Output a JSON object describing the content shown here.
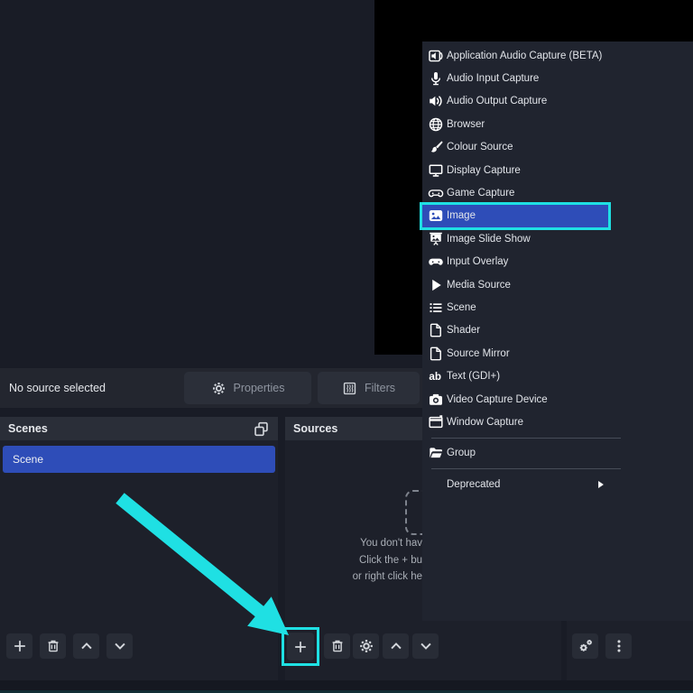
{
  "colors": {
    "accent_cyan": "#1fe0e3",
    "selection_blue": "#2e4db8"
  },
  "source_toolbar": {
    "status_text": "No source selected",
    "properties_label": "Properties",
    "filters_label": "Filters"
  },
  "scenes_panel": {
    "title": "Scenes",
    "scenes": [
      {
        "label": "Scene",
        "selected": true
      }
    ]
  },
  "sources_panel": {
    "title": "Sources",
    "empty_lines": [
      "You don't hav",
      "Click the + bu",
      "or right click he"
    ]
  },
  "add_source_menu": {
    "items": [
      {
        "label": "Application Audio Capture (BETA)",
        "icon": "app-audio-capture"
      },
      {
        "label": "Audio Input Capture",
        "icon": "microphone"
      },
      {
        "label": "Audio Output Capture",
        "icon": "speaker"
      },
      {
        "label": "Browser",
        "icon": "globe"
      },
      {
        "label": "Colour Source",
        "icon": "paintbrush"
      },
      {
        "label": "Display Capture",
        "icon": "monitor"
      },
      {
        "label": "Game Capture",
        "icon": "gamepad-outline"
      },
      {
        "label": "Image",
        "icon": "image",
        "selected": true
      },
      {
        "label": "Image Slide Show",
        "icon": "slideshow"
      },
      {
        "label": "Input Overlay",
        "icon": "gamepad"
      },
      {
        "label": "Media Source",
        "icon": "play"
      },
      {
        "label": "Scene",
        "icon": "list"
      },
      {
        "label": "Shader",
        "icon": "file"
      },
      {
        "label": "Source Mirror",
        "icon": "file"
      },
      {
        "label": "Text (GDI+)",
        "icon": "text-ab"
      },
      {
        "label": "Video Capture Device",
        "icon": "camera"
      },
      {
        "label": "Window Capture",
        "icon": "window",
        "separator_after": true
      },
      {
        "label": "Group",
        "icon": "folder",
        "separator_after": true
      },
      {
        "label": "Deprecated",
        "icon": null,
        "submenu": true
      }
    ]
  }
}
